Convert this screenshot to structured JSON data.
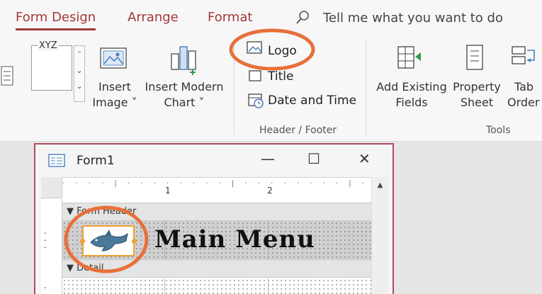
{
  "tabs": [
    {
      "label": "Form Design",
      "active": true
    },
    {
      "label": "Arrange",
      "active": false
    },
    {
      "label": "Format",
      "active": false
    }
  ],
  "tell_me": "Tell me what you want to do",
  "ribbon": {
    "xyz_text": "XYZ",
    "insert_image": [
      "Insert",
      "Image ˅"
    ],
    "insert_modern_chart": [
      "Insert Modern",
      "Chart ˅"
    ],
    "header_footer": {
      "logo": "Logo",
      "title": "Title",
      "date_time": "Date and Time",
      "group_label": "Header / Footer"
    },
    "add_existing_fields": [
      "Add Existing",
      "Fields"
    ],
    "property_sheet": [
      "Property",
      "Sheet"
    ],
    "tab_order": [
      "Tab",
      "Order"
    ],
    "tools_label": "Tools"
  },
  "form_window": {
    "title": "Form1",
    "minimize": "—",
    "maximize": "☐",
    "close": "✕",
    "ruler_marks": [
      "1",
      "2"
    ],
    "form_header_label": "Form Header",
    "detail_label": "Detail",
    "header_text": "Main Menu"
  },
  "colors": {
    "accent": "#a4373a",
    "highlight_ring": "#e8703a"
  }
}
